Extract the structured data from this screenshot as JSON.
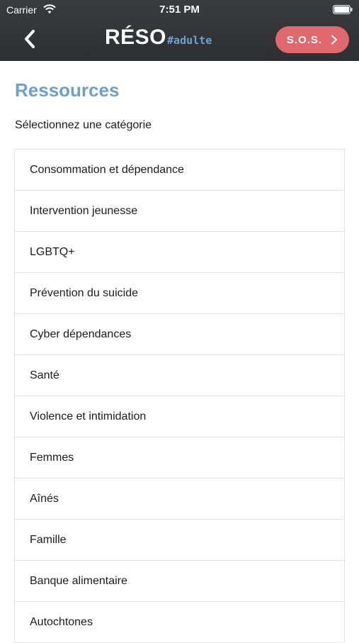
{
  "status_bar": {
    "carrier": "Carrier",
    "time": "7:51 PM"
  },
  "header": {
    "logo_main": "RÉSO",
    "logo_tag": "#adulte",
    "sos_label": "S.O.S."
  },
  "page": {
    "title": "Ressources",
    "subtitle": "Sélectionnez une catégorie"
  },
  "categories": [
    "Consommation et dépendance",
    "Intervention jeunesse",
    "LGBTQ+",
    "Prévention du suicide",
    "Cyber dépendances",
    "Santé",
    "Violence et intimidation",
    "Femmes",
    "Aînés",
    "Famille",
    "Banque alimentaire",
    "Autochtones"
  ],
  "colors": {
    "header_bg": "#2e2f32",
    "accent_blue": "#6f9fcd",
    "sos_red": "#e0686f"
  }
}
